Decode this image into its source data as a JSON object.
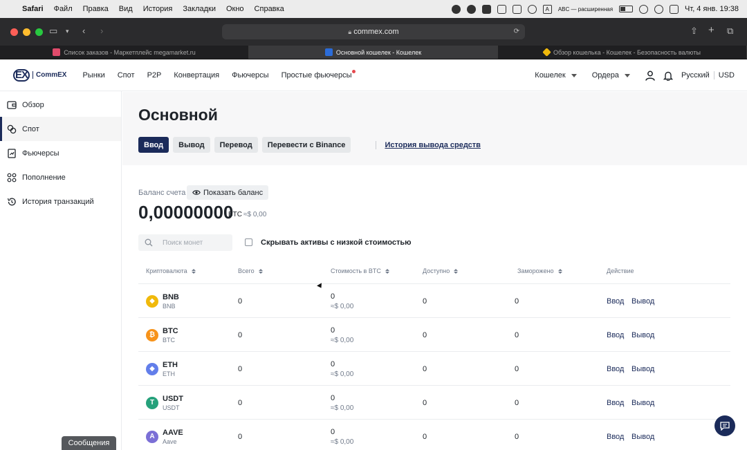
{
  "os_menu": {
    "apple": "",
    "app": "Safari",
    "items": [
      "Файл",
      "Правка",
      "Вид",
      "История",
      "Закладки",
      "Окно",
      "Справка"
    ],
    "input_badge": "A",
    "input_label": "ABC — расширенная",
    "clock": "Чт, 4 янв.  19:38"
  },
  "browser": {
    "url": "commex.com",
    "tabs": [
      {
        "title": "Список заказов - Маркетплейс megamarket.ru",
        "active": false,
        "color": "#e04b6b"
      },
      {
        "title": "Основной кошелек - Кошелек",
        "active": true,
        "color": "#2b6cd9"
      },
      {
        "title": "Обзор кошелька - Кошелек - Безопасность валюты",
        "active": false,
        "color": "#f0b90b"
      }
    ]
  },
  "header": {
    "logo_mark": "EX",
    "logo_text": "CommEX",
    "nav": [
      "Рынки",
      "Спот",
      "P2P",
      "Конвертация",
      "Фьючерсы",
      "Простые фьючерсы"
    ],
    "wallet": "Кошелек",
    "orders": "Ордера",
    "language": "Русский",
    "currency": "USD"
  },
  "sidebar": {
    "items": [
      {
        "label": "Обзор",
        "icon": "wallet-icon",
        "active": false
      },
      {
        "label": "Спот",
        "icon": "coins-icon",
        "active": true
      },
      {
        "label": "Фьючерсы",
        "icon": "futures-icon",
        "active": false
      },
      {
        "label": "Пополнение",
        "icon": "deposit-icon",
        "active": false
      },
      {
        "label": "История транзакций",
        "icon": "history-icon",
        "active": false
      }
    ]
  },
  "main": {
    "title": "Основной",
    "actions": {
      "deposit": "Ввод",
      "withdraw": "Вывод",
      "transfer": "Перевод",
      "binance": "Перевести с Binance",
      "history_link": "История вывода средств"
    },
    "balance": {
      "label": "Баланс счета",
      "show_button": "Показать баланс",
      "value": "0,00000000",
      "unit": "BTC",
      "approx": "≈$ 0,00"
    },
    "search": {
      "placeholder": "Поиск монет"
    },
    "hide_low": "Скрывать активы с низкой стоимостью"
  },
  "table": {
    "headers": {
      "crypto": "Криптовалюта",
      "total": "Всего",
      "btc_value": "Стоимость в BTC",
      "available": "Доступно",
      "frozen": "Заморожено",
      "action": "Действие"
    },
    "rows": [
      {
        "symbol": "BNB",
        "sub": "BNB",
        "total": "0",
        "btc": "0",
        "usd": "≈$ 0,00",
        "available": "0",
        "frozen": "0",
        "deposit": "Ввод",
        "withdraw": "Вывод",
        "color": "#f0b90b",
        "glyph": "◆"
      },
      {
        "symbol": "BTC",
        "sub": "BTC",
        "total": "0",
        "btc": "0",
        "usd": "≈$ 0,00",
        "available": "0",
        "frozen": "0",
        "deposit": "Ввод",
        "withdraw": "Вывод",
        "color": "#f7931a",
        "glyph": "₿"
      },
      {
        "symbol": "ETH",
        "sub": "ETH",
        "total": "0",
        "btc": "0",
        "usd": "≈$ 0,00",
        "available": "0",
        "frozen": "0",
        "deposit": "Ввод",
        "withdraw": "Вывод",
        "color": "#627eea",
        "glyph": "◆"
      },
      {
        "symbol": "USDT",
        "sub": "USDT",
        "total": "0",
        "btc": "0",
        "usd": "≈$ 0,00",
        "available": "0",
        "frozen": "0",
        "deposit": "Ввод",
        "withdraw": "Вывод",
        "color": "#26a17b",
        "glyph": "T"
      },
      {
        "symbol": "AAVE",
        "sub": "Aave",
        "total": "0",
        "btc": "0",
        "usd": "≈$ 0,00",
        "available": "0",
        "frozen": "0",
        "deposit": "Ввод",
        "withdraw": "Вывод",
        "color": "#7b6fd6",
        "glyph": "A"
      }
    ]
  },
  "messages_label": "Сообщения"
}
